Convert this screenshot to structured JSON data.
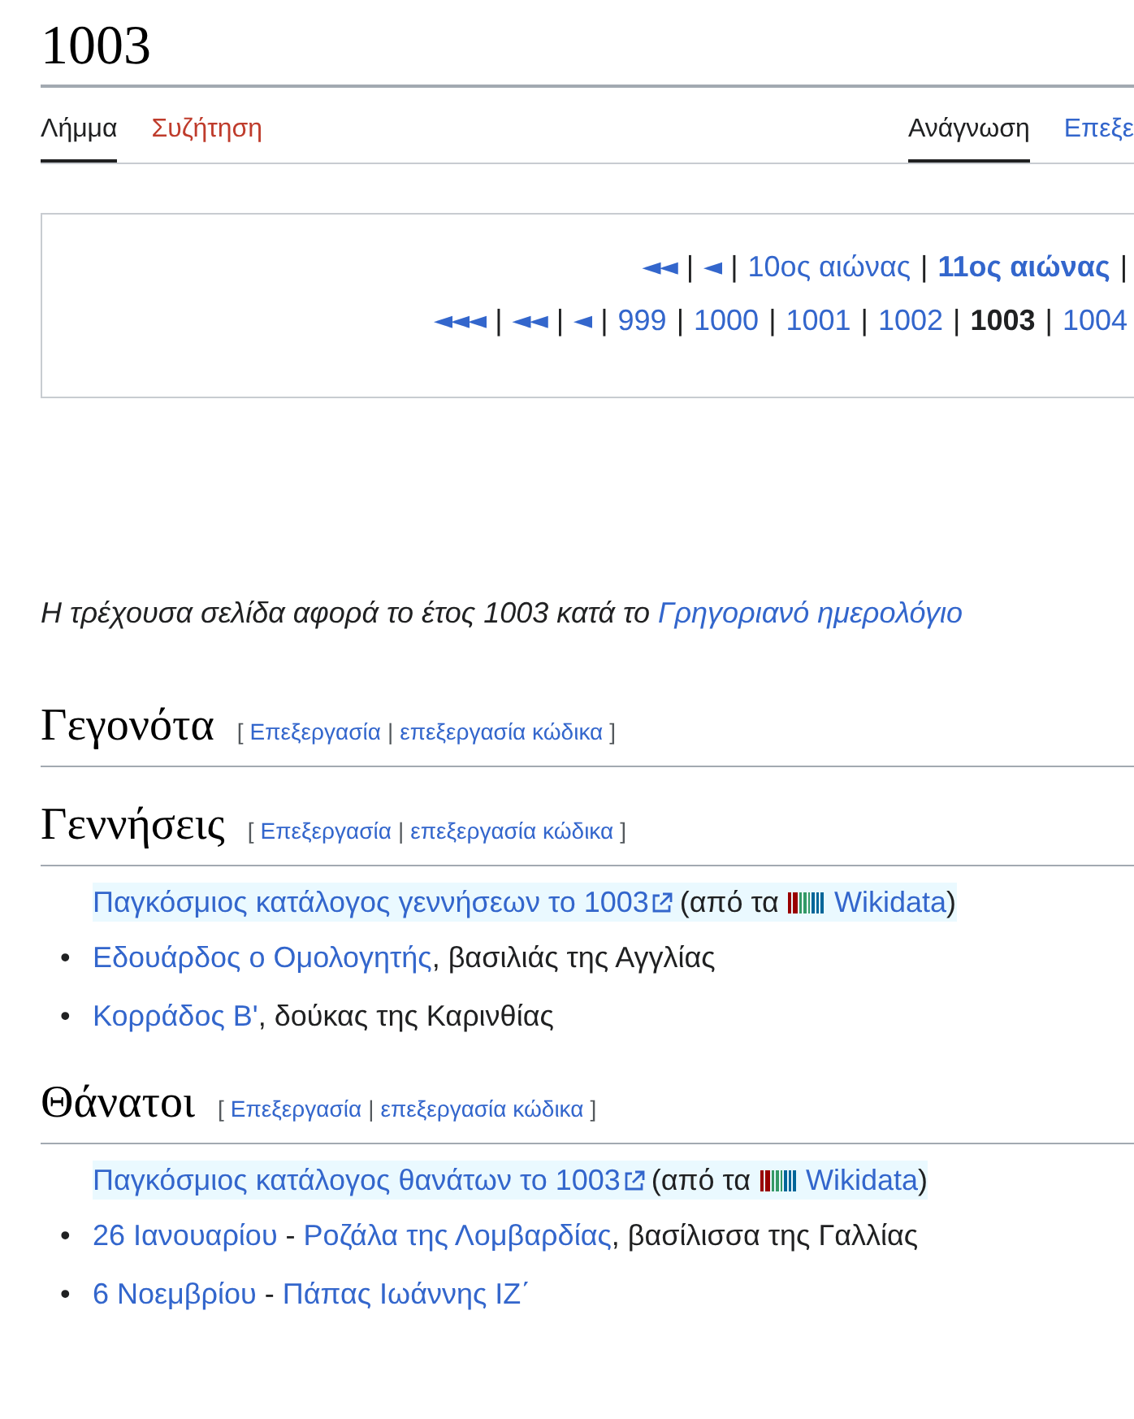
{
  "title": "1003",
  "tabs_left": [
    {
      "label": "Λήμμα",
      "selected": true,
      "kind": "page"
    },
    {
      "label": "Συζήτηση",
      "selected": false,
      "kind": "redlink"
    }
  ],
  "tabs_right": [
    {
      "label": "Ανάγνωση",
      "selected": true,
      "kind": "page"
    },
    {
      "label": "Επεξε",
      "selected": false,
      "kind": "page"
    }
  ],
  "navbox": {
    "centuries": [
      {
        "text": "◄◄",
        "kind": "arrow"
      },
      {
        "text": "|",
        "kind": "sep"
      },
      {
        "text": "◄",
        "kind": "arrow"
      },
      {
        "text": "|",
        "kind": "sep"
      },
      {
        "text": "10ος αιώνας",
        "kind": "link"
      },
      {
        "text": "|",
        "kind": "sep"
      },
      {
        "text": "11ος αιώνας",
        "kind": "boldlink"
      },
      {
        "text": "|",
        "kind": "sep"
      }
    ],
    "years": [
      {
        "text": "◄◄◄",
        "kind": "arrow"
      },
      {
        "text": "|",
        "kind": "sep"
      },
      {
        "text": "◄◄",
        "kind": "arrow"
      },
      {
        "text": "|",
        "kind": "sep"
      },
      {
        "text": "◄",
        "kind": "arrow"
      },
      {
        "text": "|",
        "kind": "sep"
      },
      {
        "text": "999",
        "kind": "link"
      },
      {
        "text": "|",
        "kind": "sep"
      },
      {
        "text": "1000",
        "kind": "link"
      },
      {
        "text": "|",
        "kind": "sep"
      },
      {
        "text": "1001",
        "kind": "link"
      },
      {
        "text": "|",
        "kind": "sep"
      },
      {
        "text": "1002",
        "kind": "link"
      },
      {
        "text": "|",
        "kind": "sep"
      },
      {
        "text": "1003",
        "kind": "current"
      },
      {
        "text": "|",
        "kind": "sep"
      },
      {
        "text": "1004",
        "kind": "link"
      }
    ]
  },
  "hatnote": {
    "text": "Η τρέχουσα σελίδα αφορά το έτος 1003 κατά το",
    "link": "Γρηγοριανό ημερολόγιο"
  },
  "sections": [
    {
      "heading": "Γεγονότα",
      "edit": {
        "open": "[",
        "edit": "Επεξεργασία",
        "sep": "|",
        "source": "επεξεργασία κώδικα",
        "close": "]"
      }
    },
    {
      "heading": "Γεννήσεις",
      "edit": {
        "open": "[",
        "edit": "Επεξεργασία",
        "sep": "|",
        "source": "επεξεργασία κώδικα",
        "close": "]"
      },
      "wikidata": {
        "link": "Παγκόσμιος κατάλογος γεννήσεων το 1003",
        "before": "(από τα",
        "source": "Wikidata",
        "after": ")"
      },
      "items": [
        {
          "marker": "•",
          "parts": [
            {
              "text": "Εδουάρδος ο Ομολογητής",
              "kind": "link"
            },
            {
              "text": ", βασιλιάς της Αγγλίας",
              "kind": "text"
            }
          ]
        },
        {
          "marker": "•",
          "parts": [
            {
              "text": "Κορράδος Β'",
              "kind": "link"
            },
            {
              "text": ", δούκας της Καρινθίας",
              "kind": "text"
            }
          ]
        }
      ]
    },
    {
      "heading": "Θάνατοι",
      "edit": {
        "open": "[",
        "edit": "Επεξεργασία",
        "sep": "|",
        "source": "επεξεργασία κώδικα",
        "close": "]"
      },
      "wikidata": {
        "link": "Παγκόσμιος κατάλογος θανάτων το 1003",
        "before": "(από τα",
        "source": "Wikidata",
        "after": ")"
      },
      "items": [
        {
          "marker": "•",
          "parts": [
            {
              "text": "26 Ιανουαρίου",
              "kind": "link"
            },
            {
              "text": " - ",
              "kind": "text"
            },
            {
              "text": "Ροζάλα της Λομβαρδίας",
              "kind": "link"
            },
            {
              "text": ", βασίλισσα της Γαλλίας",
              "kind": "text"
            }
          ]
        },
        {
          "marker": "•",
          "parts": [
            {
              "text": "6 Νοεμβρίου",
              "kind": "link"
            },
            {
              "text": " - ",
              "kind": "text"
            },
            {
              "text": "Πάπας Ιωάννης ΙΖ΄",
              "kind": "link"
            }
          ]
        }
      ]
    }
  ]
}
